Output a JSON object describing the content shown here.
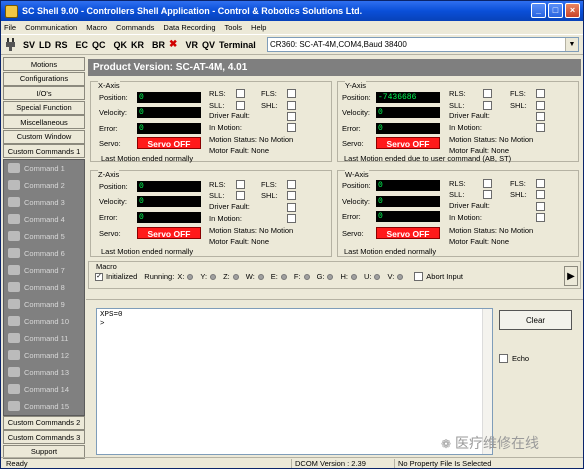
{
  "window": {
    "title": "SC Shell 9.00 - Controllers Shell Application - Control & Robotics Solutions Ltd."
  },
  "menu": [
    "File",
    "Communication",
    "Macro",
    "Commands",
    "Data Recording",
    "Tools",
    "Help"
  ],
  "toolbar": {
    "items": [
      "SV",
      "LD",
      "RS",
      "EC",
      "QC",
      "QK",
      "KR",
      "BR",
      "VR",
      "QV",
      "Terminal"
    ],
    "connection": "CR360: SC-AT-4M,COM4,Baud 38400"
  },
  "sidebar": {
    "top": [
      "Motions",
      "Configurations",
      "I/O's",
      "Special Function",
      "Miscellaneous",
      "Custom Window",
      "Custom Commands 1"
    ],
    "commands": [
      "Command 1",
      "Command 2",
      "Command 3",
      "Command 4",
      "Command 5",
      "Command 6",
      "Command 7",
      "Command 8",
      "Command 9",
      "Command 10",
      "Command 11",
      "Command 12",
      "Command 13",
      "Command 14",
      "Command 15"
    ],
    "bottom": [
      "Custom Commands 2",
      "Custom Commands 3",
      "Support"
    ]
  },
  "product": "Product Version: SC-AT-4M, 4.01",
  "labels": {
    "position": "Position:",
    "velocity": "Velocity:",
    "error": "Error:",
    "servo": "Servo:",
    "rls": "RLS:",
    "fls": "FLS:",
    "sll": "SLL:",
    "shl": "SHL:",
    "driver_fault": "Driver Fault:",
    "in_motion": "In Motion:"
  },
  "axes": [
    {
      "name": "X-Axis",
      "position": "0",
      "velocity": "0",
      "error": "0",
      "servo": "Servo OFF",
      "motion_status": "Motion Status: No Motion",
      "motor_fault": "Motor Fault: None",
      "last_motion": "Last Motion ended normally"
    },
    {
      "name": "Y-Axis",
      "position": "-7436686",
      "velocity": "0",
      "error": "0",
      "servo": "Servo OFF",
      "motion_status": "Motion Status: No Motion",
      "motor_fault": "Motor Fault: None",
      "last_motion": "Last Motion ended due to user command (AB, ST)"
    },
    {
      "name": "Z-Axis",
      "position": "0",
      "velocity": "0",
      "error": "0",
      "servo": "Servo OFF",
      "motion_status": "Motion Status: No Motion",
      "motor_fault": "Motor Fault: None",
      "last_motion": "Last Motion ended normally"
    },
    {
      "name": "W-Axis",
      "position": "0",
      "velocity": "0",
      "error": "0",
      "servo": "Servo OFF",
      "motion_status": "Motion Status: No Motion",
      "motor_fault": "Motor Fault: None",
      "last_motion": "Last Motion ended normally"
    }
  ],
  "macro": {
    "title": "Macro",
    "initialized": "Initialized",
    "running": "Running:",
    "letters": [
      "X:",
      "Y:",
      "Z:",
      "W:",
      "E:",
      "F:",
      "G:",
      "H:",
      "U:",
      "V:"
    ],
    "abort": "Abort Input"
  },
  "console": {
    "lines": [
      "XPS=0",
      ">"
    ],
    "clear": "Clear",
    "echo": "Echo"
  },
  "status": {
    "ready": "Ready",
    "dcom": "DCOM Version : 2.39",
    "property": "No Property File Is Selected"
  },
  "watermark": "医疗维修在线"
}
